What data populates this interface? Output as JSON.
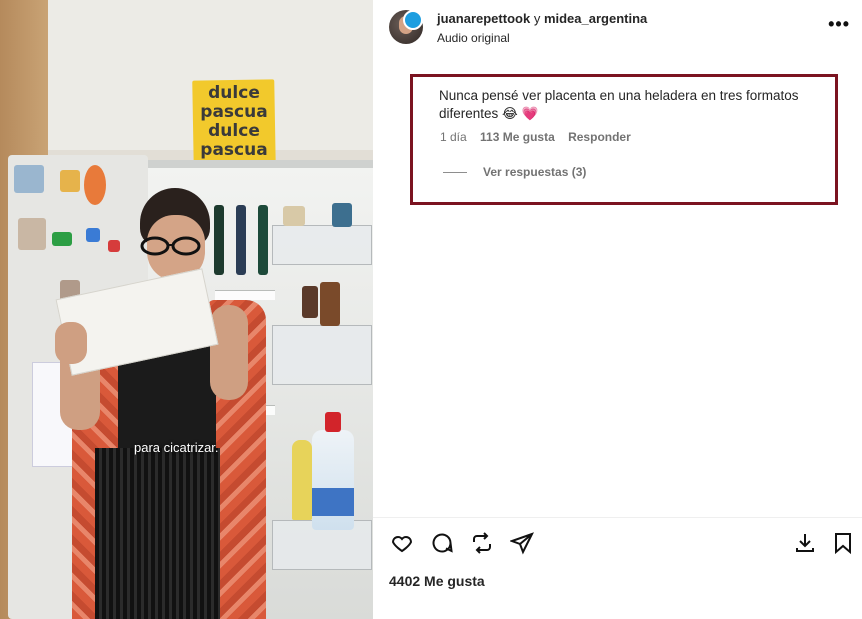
{
  "video": {
    "caption": "para cicatrizar.",
    "bag_text": "dulce pascua dulce pascua"
  },
  "post": {
    "author": "juanarepettook",
    "connector": "y",
    "collaborator": "midea_argentina",
    "audio": "Audio original",
    "more_icon": "more-options-icon"
  },
  "comment": {
    "text": "Nunca pensé ver placenta en una heladera en tres formatos diferentes 😂 💗",
    "time": "1 día",
    "likes": "113 Me gusta",
    "reply": "Responder",
    "view_replies": "Ver respuestas (3)",
    "highlight_color": "#7b1320"
  },
  "actions": {
    "icons": [
      "heart-icon",
      "comment-icon",
      "repost-icon",
      "share-icon",
      "download-icon",
      "bookmark-icon"
    ]
  },
  "likes_total": "4402 Me gusta"
}
